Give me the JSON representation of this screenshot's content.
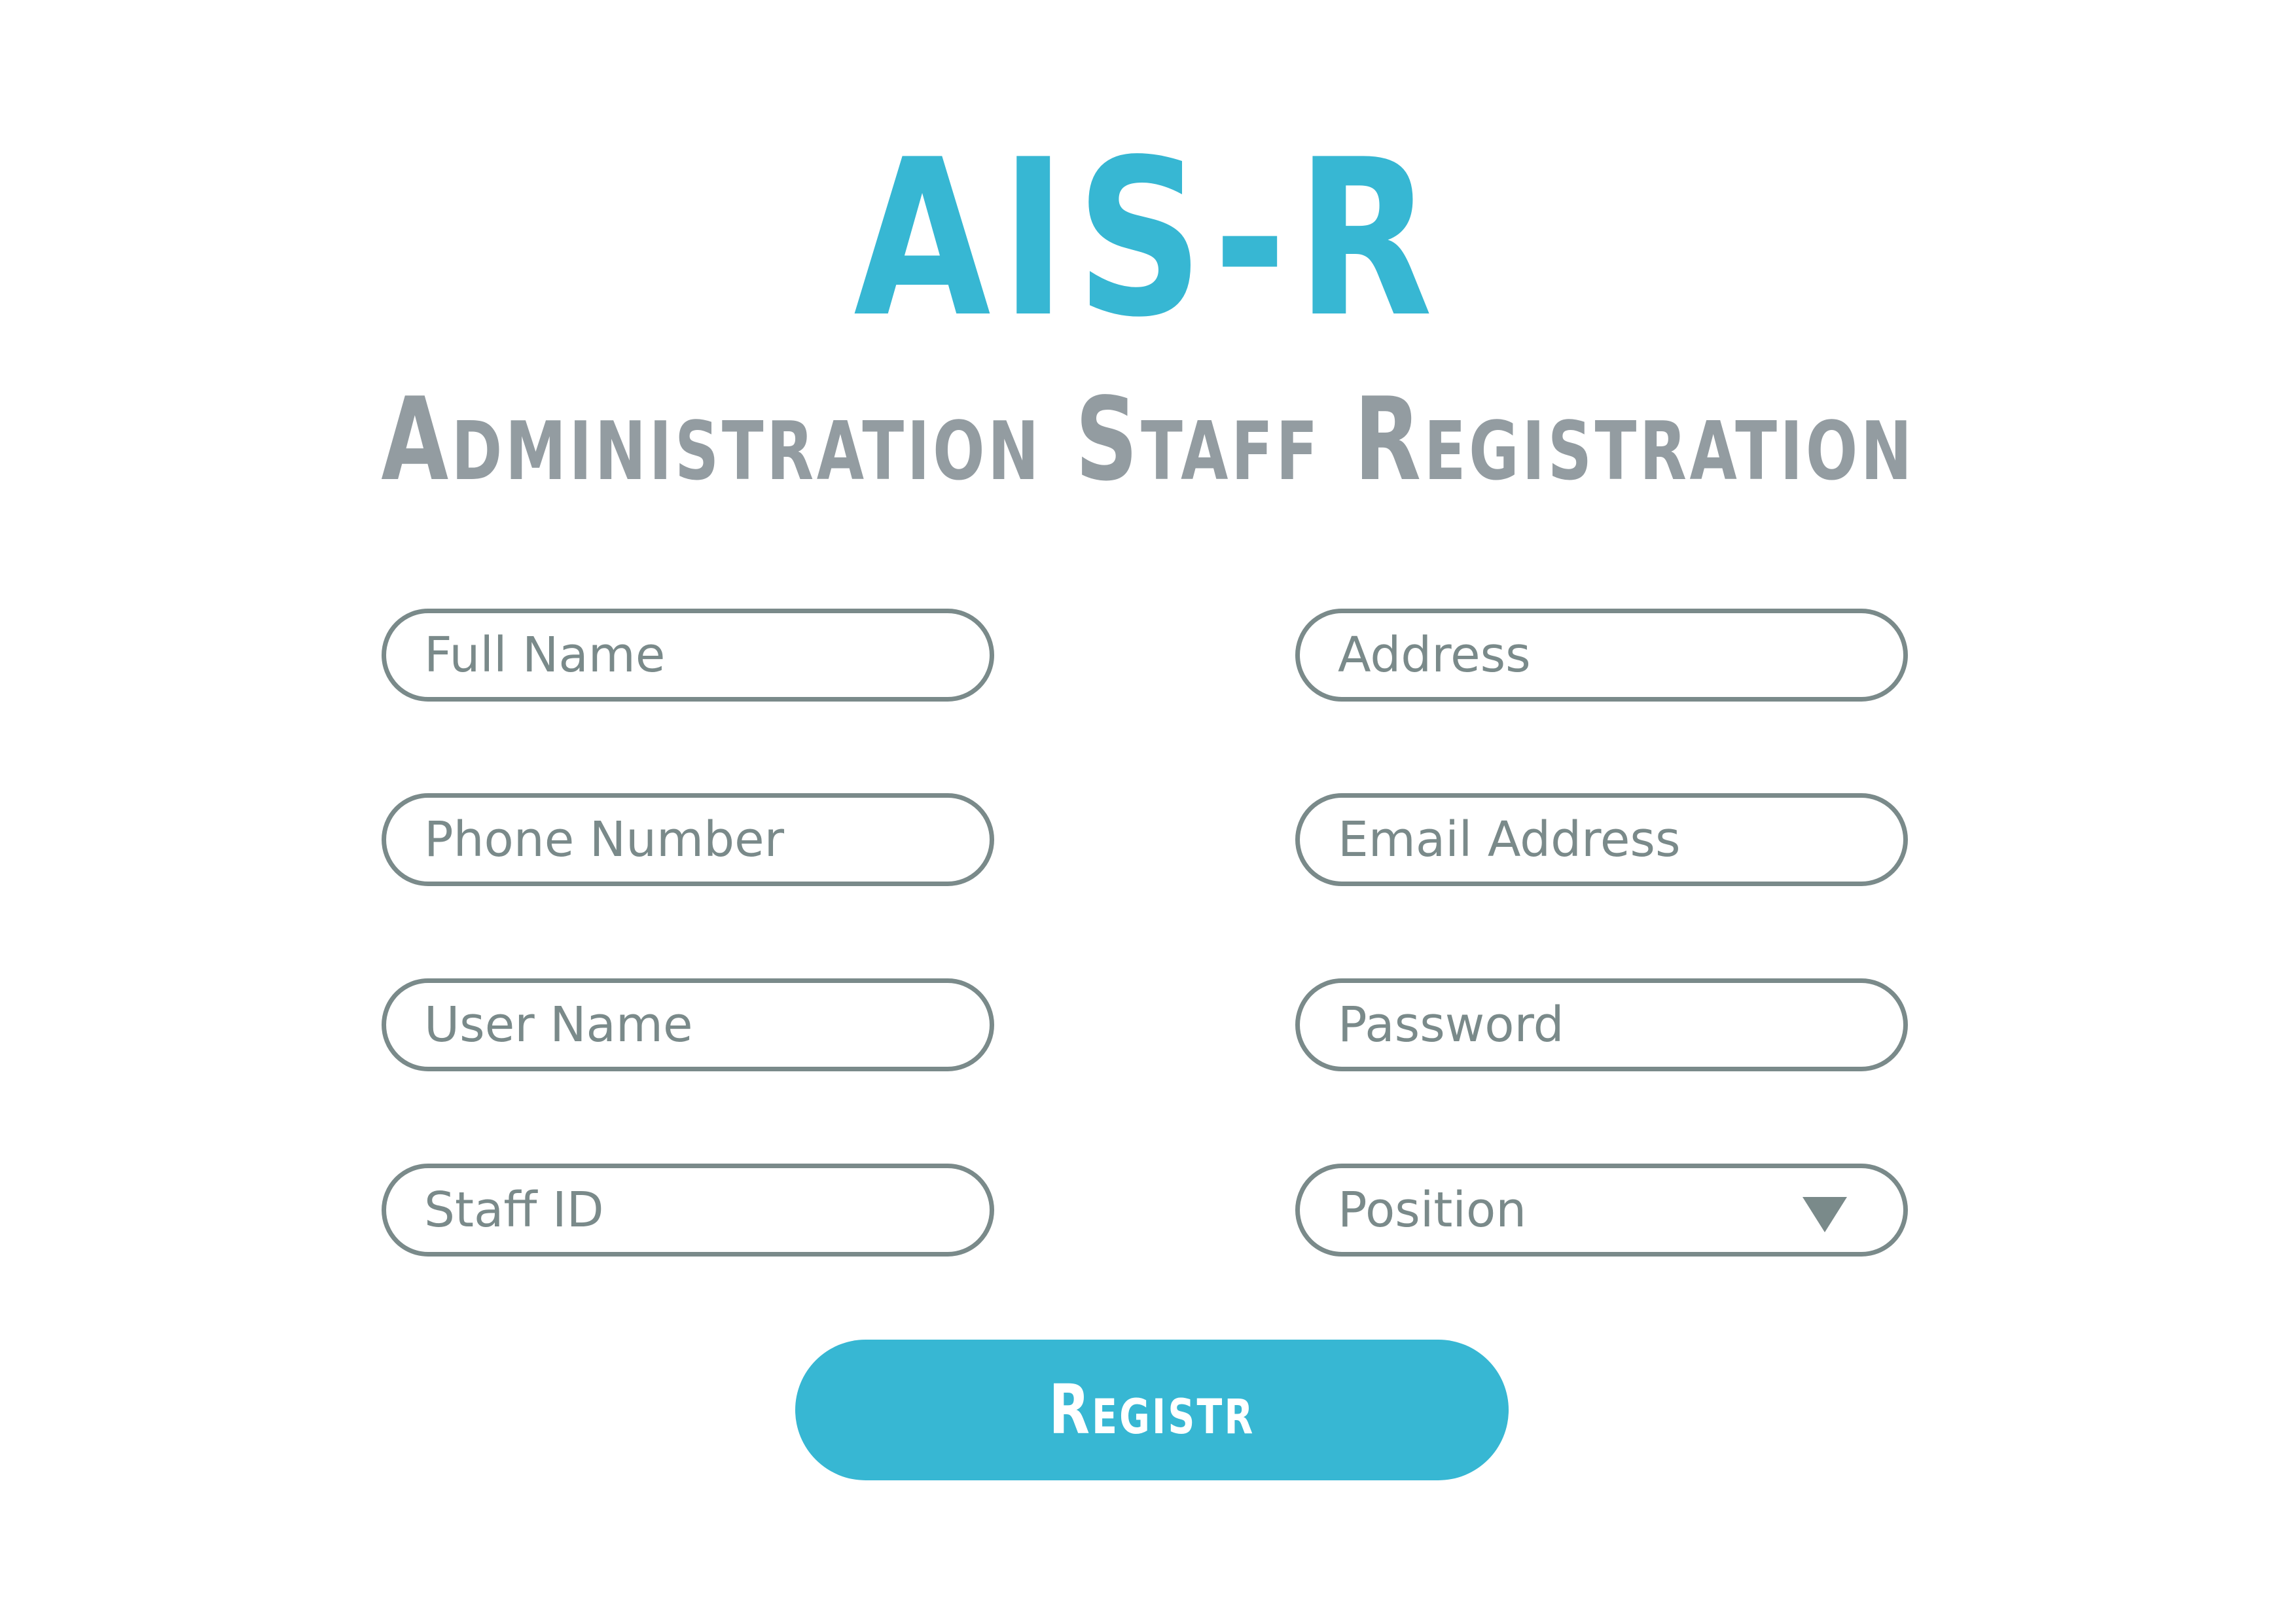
{
  "header": {
    "title": "AIS-R",
    "subtitle": "Administration Staff Registration"
  },
  "form": {
    "fields": [
      {
        "placeholder": "Full Name"
      },
      {
        "placeholder": "Address"
      },
      {
        "placeholder": "Phone Number"
      },
      {
        "placeholder": "Email Address"
      },
      {
        "placeholder": "User Name"
      },
      {
        "placeholder": "Password"
      },
      {
        "placeholder": "Staff ID"
      },
      {
        "placeholder": "Position",
        "icon": "dropdown-triangle-icon"
      }
    ],
    "submit_label": "Registr"
  },
  "colors": {
    "accent": "#37b7d3",
    "subtitle": "#939ca1",
    "field_border": "#7a8a8a",
    "placeholder": "#7a8a8a",
    "background": "#ffffff"
  }
}
